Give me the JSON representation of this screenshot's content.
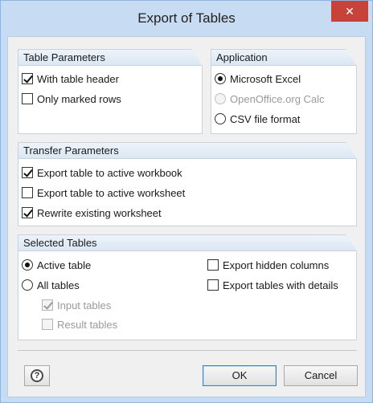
{
  "window": {
    "title": "Export of Tables",
    "close_glyph": "✕"
  },
  "table_parameters": {
    "header": "Table Parameters",
    "with_table_header": {
      "label": "With table header",
      "checked": true
    },
    "only_marked_rows": {
      "label": "Only marked rows",
      "checked": false
    }
  },
  "application": {
    "header": "Application",
    "options": [
      {
        "label": "Microsoft Excel",
        "selected": true,
        "enabled": true
      },
      {
        "label": "OpenOffice.org Calc",
        "selected": false,
        "enabled": false
      },
      {
        "label": "CSV file format",
        "selected": false,
        "enabled": true
      }
    ]
  },
  "transfer_parameters": {
    "header": "Transfer Parameters",
    "export_to_active_workbook": {
      "label": "Export table to active workbook",
      "checked": true
    },
    "export_to_active_worksheet": {
      "label": "Export table to active worksheet",
      "checked": false
    },
    "rewrite_existing_worksheet": {
      "label": "Rewrite existing worksheet",
      "checked": true
    }
  },
  "selected_tables": {
    "header": "Selected Tables",
    "active_table": {
      "label": "Active table",
      "selected": true
    },
    "all_tables": {
      "label": "All tables",
      "selected": false
    },
    "input_tables": {
      "label": "Input tables",
      "checked": true,
      "enabled": false
    },
    "result_tables": {
      "label": "Result tables",
      "checked": false,
      "enabled": false
    },
    "export_hidden_columns": {
      "label": "Export hidden columns",
      "checked": false
    },
    "export_tables_with_details": {
      "label": "Export tables with details",
      "checked": false
    }
  },
  "footer": {
    "help_icon": "help-icon",
    "help_glyph": "?",
    "ok_label": "OK",
    "cancel_label": "Cancel"
  },
  "colors": {
    "title_bar": "#c7dcf2",
    "close_button": "#c7433a",
    "group_header": "#dbe7f4"
  }
}
